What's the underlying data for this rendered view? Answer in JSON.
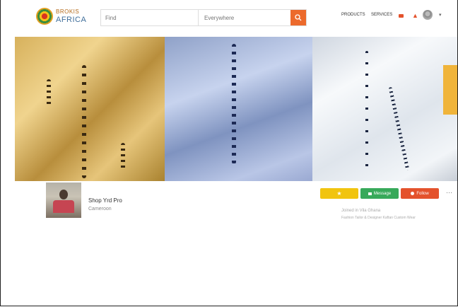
{
  "brand": {
    "line1": "BROKIS",
    "line2": "AFRICA"
  },
  "search": {
    "query_placeholder": "Find",
    "location_placeholder": "Everywhere"
  },
  "nav": {
    "link1": "PRODUCTS",
    "link2": "SERVICES"
  },
  "profile": {
    "name": "Shop Yrd Pro",
    "location": "Cameroon",
    "btn_yellow": "★",
    "btn_message": "Message",
    "btn_follow": "Follow",
    "info_line1": "Joined in Vila Ghana",
    "info_line2": "Fashion Tailor & Designer Kaftan Custom Wear"
  },
  "colors": {
    "accent": "#ec6a2c",
    "green": "#37a95a",
    "yellow": "#f1c40f"
  }
}
